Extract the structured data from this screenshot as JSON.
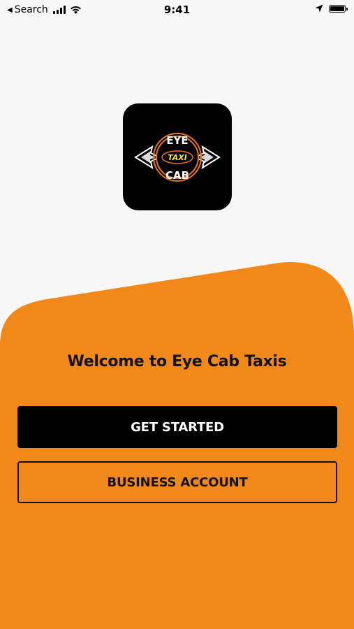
{
  "status_bar": {
    "back_label": "Search",
    "time": "9:41"
  },
  "icons": {
    "back": "back-arrow-icon",
    "signal": "cellular-signal-icon",
    "wifi": "wifi-icon",
    "location": "location-arrow-icon",
    "battery": "battery-icon"
  },
  "logo": {
    "line1": "EYE",
    "line2": "TAXI",
    "line3": "CAB"
  },
  "main": {
    "welcome_text": "Welcome to Eye Cab Taxis",
    "get_started_label": "GET STARTED",
    "business_account_label": "BUSINESS ACCOUNT"
  },
  "colors": {
    "accent": "#f0881a",
    "background": "#f7f7f7",
    "button_dark": "#000000",
    "logo_ring": "#e8741e",
    "logo_taxi": "#f5e12a"
  }
}
